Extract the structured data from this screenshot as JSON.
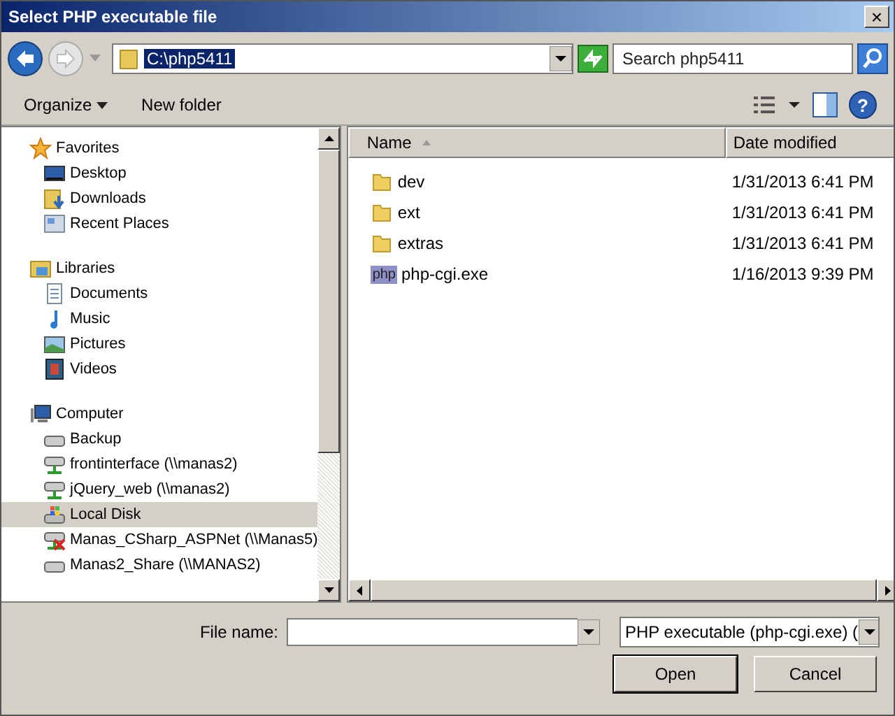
{
  "window": {
    "title": "Select PHP executable file",
    "close": "×"
  },
  "address": {
    "value": "C:\\php5411"
  },
  "search": {
    "placeholder": "Search php5411"
  },
  "toolbar": {
    "organize": "Organize",
    "new_folder": "New folder",
    "help": "?"
  },
  "sidebar": {
    "items": [
      {
        "label": "Favorites",
        "kind": "group",
        "selected": false
      },
      {
        "label": "Desktop",
        "kind": "item",
        "selected": false
      },
      {
        "label": "Downloads",
        "kind": "item",
        "selected": false
      },
      {
        "label": "Recent Places",
        "kind": "item",
        "selected": false
      },
      {
        "label": "Libraries",
        "kind": "group",
        "selected": false
      },
      {
        "label": "Documents",
        "kind": "item",
        "selected": false
      },
      {
        "label": "Music",
        "kind": "item",
        "selected": false
      },
      {
        "label": "Pictures",
        "kind": "item",
        "selected": false
      },
      {
        "label": "Videos",
        "kind": "item",
        "selected": false
      },
      {
        "label": "Computer",
        "kind": "group",
        "selected": false
      },
      {
        "label": "Backup",
        "kind": "item",
        "selected": false
      },
      {
        "label": "frontinterface (\\\\manas2)",
        "kind": "item",
        "selected": false
      },
      {
        "label": "jQuery_web (\\\\manas2)",
        "kind": "item",
        "selected": false
      },
      {
        "label": "Local Disk",
        "kind": "item",
        "selected": true
      },
      {
        "label": "Manas_CSharp_ASPNet (\\\\Manas5)",
        "kind": "item",
        "selected": false
      },
      {
        "label": "Manas2_Share (\\\\MANAS2)",
        "kind": "item",
        "selected": false
      }
    ]
  },
  "table": {
    "columns": [
      "Name",
      "Date modified"
    ],
    "rows": [
      {
        "name": "dev",
        "date": "1/31/2013 6:41 PM",
        "kind": "folder"
      },
      {
        "name": "ext",
        "date": "1/31/2013 6:41 PM",
        "kind": "folder"
      },
      {
        "name": "extras",
        "date": "1/31/2013 6:41 PM",
        "kind": "folder"
      },
      {
        "name": "php-cgi.exe",
        "date": "1/16/2013 9:39 PM",
        "kind": "file",
        "icon_text": "php"
      }
    ]
  },
  "footer": {
    "file_name_label": "File name:",
    "file_type": "PHP executable (php-cgi.exe) (",
    "buttons": [
      "Open",
      "Cancel"
    ]
  }
}
